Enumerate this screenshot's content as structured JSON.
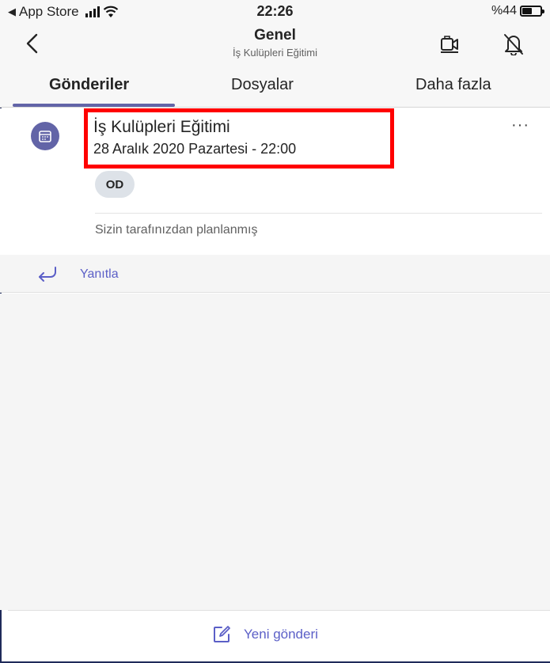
{
  "status_bar": {
    "back_to": "App Store",
    "time": "22:26",
    "battery": "%44"
  },
  "header": {
    "title": "Genel",
    "subtitle": "İş Kulüpleri Eğitimi"
  },
  "tabs": [
    {
      "label": "Gönderiler",
      "active": true
    },
    {
      "label": "Dosyalar",
      "active": false
    },
    {
      "label": "Daha fazla",
      "active": false
    }
  ],
  "post": {
    "title": "İş Kulüpleri Eğitimi",
    "date": "28 Aralık 2020 Pazartesi - 22:00",
    "attendee_initials": "OD",
    "planned_by": "Sizin tarafınızdan planlanmış",
    "more": "···"
  },
  "reply": {
    "label": "Yanıtla"
  },
  "compose": {
    "label": "Yeni gönderi"
  },
  "colors": {
    "accent": "#6264a7",
    "link": "#5b5fc7",
    "highlight": "#ff0000"
  }
}
